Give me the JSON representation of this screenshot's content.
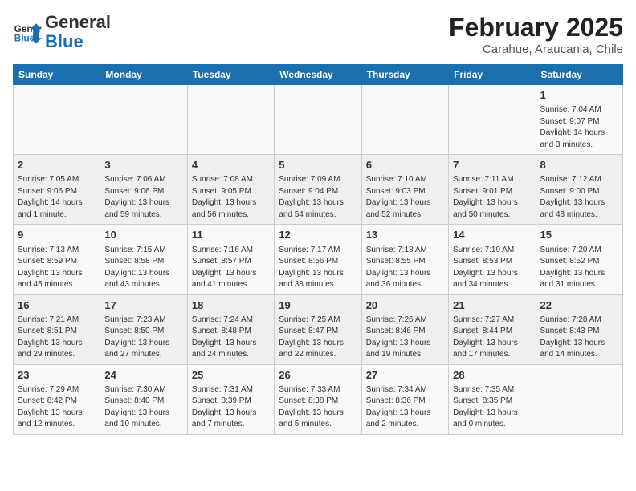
{
  "header": {
    "logo_general": "General",
    "logo_blue": "Blue",
    "month_title": "February 2025",
    "location": "Carahue, Araucania, Chile"
  },
  "weekdays": [
    "Sunday",
    "Monday",
    "Tuesday",
    "Wednesday",
    "Thursday",
    "Friday",
    "Saturday"
  ],
  "weeks": [
    [
      {
        "day": "",
        "info": ""
      },
      {
        "day": "",
        "info": ""
      },
      {
        "day": "",
        "info": ""
      },
      {
        "day": "",
        "info": ""
      },
      {
        "day": "",
        "info": ""
      },
      {
        "day": "",
        "info": ""
      },
      {
        "day": "1",
        "info": "Sunrise: 7:04 AM\nSunset: 9:07 PM\nDaylight: 14 hours and 3 minutes."
      }
    ],
    [
      {
        "day": "2",
        "info": "Sunrise: 7:05 AM\nSunset: 9:06 PM\nDaylight: 14 hours and 1 minute."
      },
      {
        "day": "3",
        "info": "Sunrise: 7:06 AM\nSunset: 9:06 PM\nDaylight: 13 hours and 59 minutes."
      },
      {
        "day": "4",
        "info": "Sunrise: 7:08 AM\nSunset: 9:05 PM\nDaylight: 13 hours and 56 minutes."
      },
      {
        "day": "5",
        "info": "Sunrise: 7:09 AM\nSunset: 9:04 PM\nDaylight: 13 hours and 54 minutes."
      },
      {
        "day": "6",
        "info": "Sunrise: 7:10 AM\nSunset: 9:03 PM\nDaylight: 13 hours and 52 minutes."
      },
      {
        "day": "7",
        "info": "Sunrise: 7:11 AM\nSunset: 9:01 PM\nDaylight: 13 hours and 50 minutes."
      },
      {
        "day": "8",
        "info": "Sunrise: 7:12 AM\nSunset: 9:00 PM\nDaylight: 13 hours and 48 minutes."
      }
    ],
    [
      {
        "day": "9",
        "info": "Sunrise: 7:13 AM\nSunset: 8:59 PM\nDaylight: 13 hours and 45 minutes."
      },
      {
        "day": "10",
        "info": "Sunrise: 7:15 AM\nSunset: 8:58 PM\nDaylight: 13 hours and 43 minutes."
      },
      {
        "day": "11",
        "info": "Sunrise: 7:16 AM\nSunset: 8:57 PM\nDaylight: 13 hours and 41 minutes."
      },
      {
        "day": "12",
        "info": "Sunrise: 7:17 AM\nSunset: 8:56 PM\nDaylight: 13 hours and 38 minutes."
      },
      {
        "day": "13",
        "info": "Sunrise: 7:18 AM\nSunset: 8:55 PM\nDaylight: 13 hours and 36 minutes."
      },
      {
        "day": "14",
        "info": "Sunrise: 7:19 AM\nSunset: 8:53 PM\nDaylight: 13 hours and 34 minutes."
      },
      {
        "day": "15",
        "info": "Sunrise: 7:20 AM\nSunset: 8:52 PM\nDaylight: 13 hours and 31 minutes."
      }
    ],
    [
      {
        "day": "16",
        "info": "Sunrise: 7:21 AM\nSunset: 8:51 PM\nDaylight: 13 hours and 29 minutes."
      },
      {
        "day": "17",
        "info": "Sunrise: 7:23 AM\nSunset: 8:50 PM\nDaylight: 13 hours and 27 minutes."
      },
      {
        "day": "18",
        "info": "Sunrise: 7:24 AM\nSunset: 8:48 PM\nDaylight: 13 hours and 24 minutes."
      },
      {
        "day": "19",
        "info": "Sunrise: 7:25 AM\nSunset: 8:47 PM\nDaylight: 13 hours and 22 minutes."
      },
      {
        "day": "20",
        "info": "Sunrise: 7:26 AM\nSunset: 8:46 PM\nDaylight: 13 hours and 19 minutes."
      },
      {
        "day": "21",
        "info": "Sunrise: 7:27 AM\nSunset: 8:44 PM\nDaylight: 13 hours and 17 minutes."
      },
      {
        "day": "22",
        "info": "Sunrise: 7:28 AM\nSunset: 8:43 PM\nDaylight: 13 hours and 14 minutes."
      }
    ],
    [
      {
        "day": "23",
        "info": "Sunrise: 7:29 AM\nSunset: 8:42 PM\nDaylight: 13 hours and 12 minutes."
      },
      {
        "day": "24",
        "info": "Sunrise: 7:30 AM\nSunset: 8:40 PM\nDaylight: 13 hours and 10 minutes."
      },
      {
        "day": "25",
        "info": "Sunrise: 7:31 AM\nSunset: 8:39 PM\nDaylight: 13 hours and 7 minutes."
      },
      {
        "day": "26",
        "info": "Sunrise: 7:33 AM\nSunset: 8:38 PM\nDaylight: 13 hours and 5 minutes."
      },
      {
        "day": "27",
        "info": "Sunrise: 7:34 AM\nSunset: 8:36 PM\nDaylight: 13 hours and 2 minutes."
      },
      {
        "day": "28",
        "info": "Sunrise: 7:35 AM\nSunset: 8:35 PM\nDaylight: 13 hours and 0 minutes."
      },
      {
        "day": "",
        "info": ""
      }
    ]
  ]
}
